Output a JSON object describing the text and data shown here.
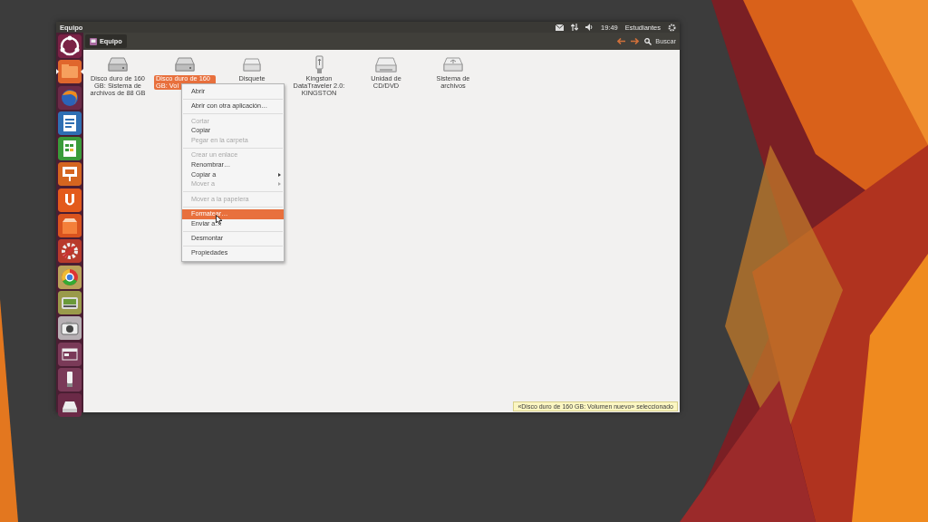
{
  "panel": {
    "title": "Equipo",
    "clock": "19:49",
    "user": "Estudiantes"
  },
  "toolbar": {
    "location": "Equipo",
    "search": "Buscar"
  },
  "launcher": [
    {
      "kind": "home",
      "running": false
    },
    {
      "kind": "files",
      "running": true
    },
    {
      "kind": "browser",
      "running": false
    },
    {
      "kind": "writer",
      "running": false
    },
    {
      "kind": "calc",
      "running": false
    },
    {
      "kind": "impress",
      "running": false
    },
    {
      "kind": "one",
      "running": false
    },
    {
      "kind": "store",
      "running": false
    },
    {
      "kind": "settings",
      "running": false
    },
    {
      "kind": "chrome",
      "running": false
    },
    {
      "kind": "disk",
      "running": false
    },
    {
      "kind": "camera",
      "running": false
    },
    {
      "kind": "window",
      "running": false
    },
    {
      "kind": "usb",
      "running": false
    },
    {
      "kind": "drive",
      "running": false
    }
  ],
  "devices": [
    {
      "kind": "hdd",
      "label": "Disco duro de 160 GB: Sistema de archivos de 88 GB",
      "selected": false
    },
    {
      "kind": "hdd",
      "label": "Disco duro de 160 GB: Vol",
      "selected": true
    },
    {
      "kind": "floppy",
      "label": "Disquete",
      "selected": false
    },
    {
      "kind": "usb",
      "label": "Kingston DataTraveler 2.0: KINGSTON",
      "selected": false
    },
    {
      "kind": "cd",
      "label": "Unidad de CD/DVD",
      "selected": false
    },
    {
      "kind": "fs",
      "label": "Sistema de archivos",
      "selected": false
    }
  ],
  "context_menu": [
    {
      "kind": "item",
      "label": "Abrir",
      "disabled": false,
      "selected": false,
      "submenu": false
    },
    {
      "kind": "separator"
    },
    {
      "kind": "item",
      "label": "Abrir con otra aplicación…",
      "disabled": false,
      "selected": false,
      "submenu": false
    },
    {
      "kind": "separator"
    },
    {
      "kind": "item",
      "label": "Cortar",
      "disabled": true,
      "selected": false,
      "submenu": false
    },
    {
      "kind": "item",
      "label": "Copiar",
      "disabled": false,
      "selected": false,
      "submenu": false
    },
    {
      "kind": "item",
      "label": "Pegar en la carpeta",
      "disabled": true,
      "selected": false,
      "submenu": false
    },
    {
      "kind": "separator"
    },
    {
      "kind": "item",
      "label": "Crear un enlace",
      "disabled": true,
      "selected": false,
      "submenu": false
    },
    {
      "kind": "item",
      "label": "Renombrar…",
      "disabled": false,
      "selected": false,
      "submenu": false
    },
    {
      "kind": "item",
      "label": "Copiar a",
      "disabled": false,
      "selected": false,
      "submenu": true
    },
    {
      "kind": "item",
      "label": "Mover a",
      "disabled": true,
      "selected": false,
      "submenu": true
    },
    {
      "kind": "separator"
    },
    {
      "kind": "item",
      "label": "Mover a la papelera",
      "disabled": true,
      "selected": false,
      "submenu": false
    },
    {
      "kind": "separator"
    },
    {
      "kind": "item",
      "label": "Formatear…",
      "disabled": false,
      "selected": true,
      "submenu": false
    },
    {
      "kind": "item",
      "label": "Enviar a…",
      "disabled": false,
      "selected": false,
      "submenu": false
    },
    {
      "kind": "separator"
    },
    {
      "kind": "item",
      "label": "Desmontar",
      "disabled": false,
      "selected": false,
      "submenu": false
    },
    {
      "kind": "separator"
    },
    {
      "kind": "item",
      "label": "Propiedades",
      "disabled": false,
      "selected": false,
      "submenu": false
    }
  ],
  "status": "«Disco duro de 160 GB: Volumen nuevo» seleccionado"
}
